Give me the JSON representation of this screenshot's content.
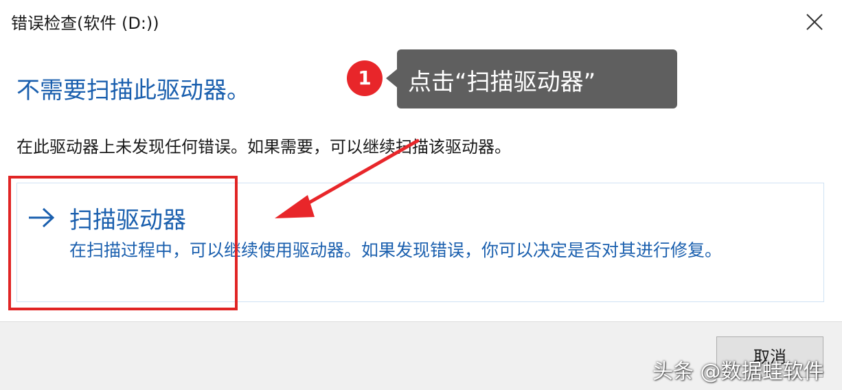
{
  "window": {
    "title": "错误检查(软件 (D:))",
    "close_icon": "close-icon"
  },
  "main": {
    "heading": "不需要扫描此驱动器。",
    "description": "在此驱动器上未发现任何错误。如果需要，可以继续扫描该驱动器。",
    "option": {
      "icon": "arrow-right-icon",
      "title": "扫描驱动器",
      "description": "在扫描过程中，可以继续使用驱动器。如果发现错误，你可以决定是否对其进行修复。"
    }
  },
  "footer": {
    "cancel_label": "取消"
  },
  "annotation": {
    "step_number": "1",
    "tooltip_text": "点击“扫描驱动器”"
  },
  "watermark": "头条 @数据蛙软件",
  "colors": {
    "accent": "#1a5fae",
    "annotation_red": "#e02424",
    "tooltip_bg": "#5f5f5f"
  }
}
